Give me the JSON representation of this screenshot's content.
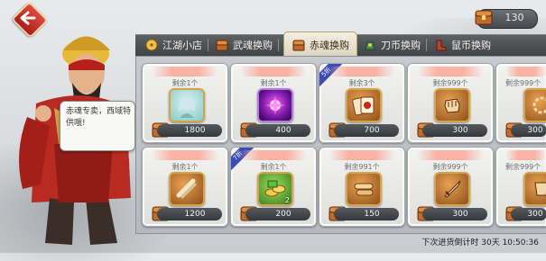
{
  "currency": {
    "amount": "130",
    "icon": "chest-icon"
  },
  "tabs": [
    {
      "label": "江湖小店",
      "icon": "coin-icon",
      "active": false
    },
    {
      "label": "武魂换购",
      "icon": "chest-icon",
      "active": false
    },
    {
      "label": "赤魂换购",
      "icon": "chest-icon",
      "active": true
    },
    {
      "label": "刀币换购",
      "icon": "treasure-icon",
      "active": false
    },
    {
      "label": "鼠币换购",
      "icon": "boot-icon",
      "active": false
    }
  ],
  "npc": {
    "speech": "赤魂专卖，西域特供哦!"
  },
  "items": [
    {
      "name": "",
      "stock": "剩余1个",
      "price": "1800",
      "old_price": "",
      "discount": "",
      "qty": "",
      "icon": "portrait-icon"
    },
    {
      "name": "",
      "stock": "剩余1个",
      "price": "400",
      "old_price": "",
      "discount": "",
      "qty": "",
      "icon": "purple-orb-icon"
    },
    {
      "name": "",
      "stock": "剩余3个",
      "price": "700",
      "old_price": "",
      "discount": "5折",
      "qty": "",
      "icon": "card-pack-icon"
    },
    {
      "name": "",
      "stock": "剩余999个",
      "price": "300",
      "old_price": "",
      "discount": "",
      "qty": "",
      "icon": "fist-icon"
    },
    {
      "name": "",
      "stock": "剩余999个",
      "price": "300",
      "old_price": "",
      "discount": "",
      "qty": "",
      "icon": "badge-icon"
    },
    {
      "name": "",
      "stock": "剩余1个",
      "price": "1200",
      "old_price": "",
      "discount": "",
      "qty": "",
      "icon": "scroll-icon"
    },
    {
      "name": "",
      "stock": "剩余1个",
      "price": "200",
      "old_price": "",
      "discount": "7折",
      "qty": "2",
      "icon": "gold-ingots-icon"
    },
    {
      "name": "",
      "stock": "剩余991个",
      "price": "150",
      "old_price": "",
      "discount": "",
      "qty": "",
      "icon": "scroll-bundle-icon"
    },
    {
      "name": "",
      "stock": "剩余999个",
      "price": "300",
      "old_price": "",
      "discount": "",
      "qty": "",
      "icon": "sword-icon"
    },
    {
      "name": "",
      "stock": "剩余999个",
      "price": "300",
      "old_price": "",
      "discount": "",
      "qty": "",
      "icon": "armor-icon"
    }
  ],
  "footer": {
    "countdown": "下次进货倒计时 30天 10:50:36"
  },
  "colors": {
    "accent": "#c8251c",
    "tab_bar": "#4b4e51",
    "card": "#eeeeeb"
  }
}
